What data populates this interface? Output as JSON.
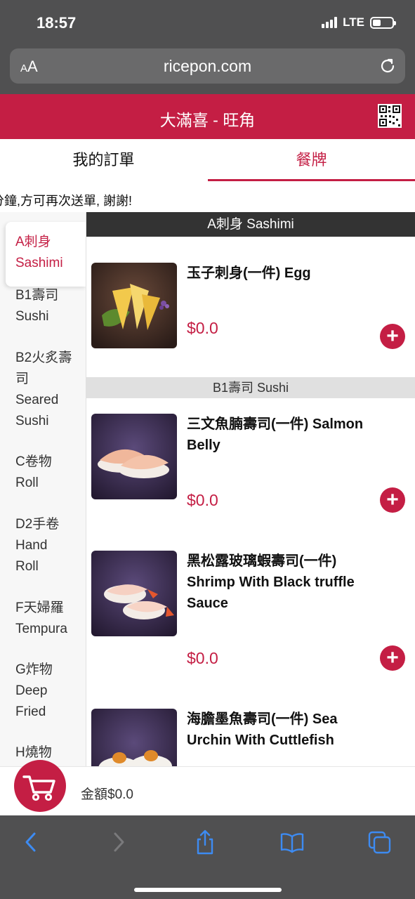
{
  "status": {
    "time": "18:57",
    "network": "LTE"
  },
  "browser": {
    "aa_small": "A",
    "aa_large": "A",
    "url": "ricepon.com"
  },
  "header": {
    "title": "大滿喜 - 旺角"
  },
  "tabs": {
    "orders": "我的訂單",
    "menu": "餐牌"
  },
  "notice": "分鐘,方可再次送單, 謝謝!",
  "sidebar": {
    "items": [
      {
        "line1": "A刺身",
        "line2": "Sashimi"
      },
      {
        "line1": "B1壽司",
        "line2": "Sushi"
      },
      {
        "line1": "B2火炙壽",
        "line2": "司",
        "line3": "Seared",
        "line4": "Sushi"
      },
      {
        "line1": "C卷物",
        "line2": "Roll"
      },
      {
        "line1": "D2手卷",
        "line2": "Hand",
        "line3": "Roll"
      },
      {
        "line1": "F天婦羅",
        "line2": "Tempura"
      },
      {
        "line1": "G炸物",
        "line2": "Deep",
        "line3": "Fried"
      },
      {
        "line1": "H燒物"
      }
    ]
  },
  "sections": {
    "a": "A刺身 Sashimi",
    "b1": "B1壽司 Sushi"
  },
  "items": [
    {
      "name_line1": "玉子刺身(一件) Egg",
      "price": "$0.0"
    },
    {
      "name_line1": "三文魚腩壽司(一件) Salmon",
      "name_line2": "Belly",
      "price": "$0.0"
    },
    {
      "name_line1": "黑松露玻璃蝦壽司(一件)",
      "name_line2": "Shrimp With Black truffle",
      "name_line3": "Sauce",
      "price": "$0.0"
    },
    {
      "name_line1": "海膽墨魚壽司(一件) Sea",
      "name_line2": "Urchin With Cuttlefish"
    }
  ],
  "cart": {
    "total": "金額$0.0"
  },
  "colors": {
    "brand": "#c41e44",
    "chrome": "#505051"
  },
  "icons": [
    "signal-icon",
    "battery-icon",
    "reload-icon",
    "qr-code-icon",
    "add-icon",
    "cart-icon",
    "back-icon",
    "forward-icon",
    "share-icon",
    "bookmarks-icon",
    "tabs-icon"
  ]
}
